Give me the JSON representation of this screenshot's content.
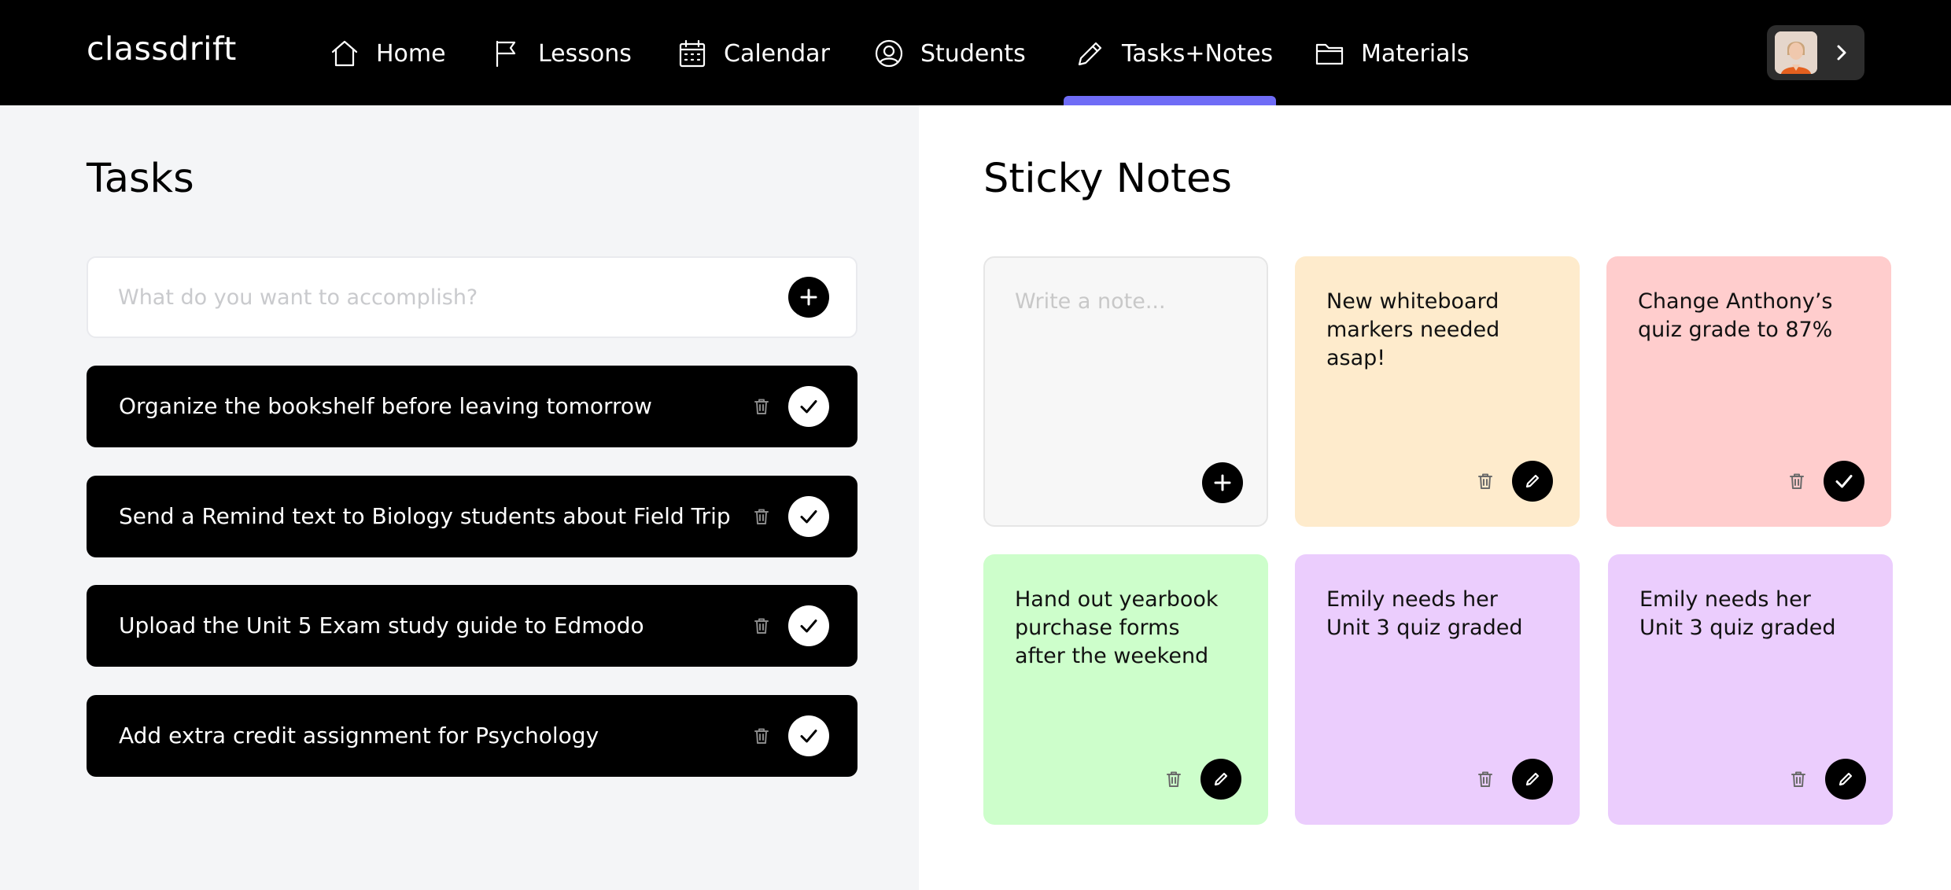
{
  "app": {
    "brand": "classdrift"
  },
  "nav": {
    "items": [
      {
        "label": "Home",
        "icon": "home-icon"
      },
      {
        "label": "Lessons",
        "icon": "flag-icon"
      },
      {
        "label": "Calendar",
        "icon": "calendar-icon"
      },
      {
        "label": "Students",
        "icon": "user-circle-icon"
      },
      {
        "label": "Tasks+Notes",
        "icon": "pencil-icon",
        "active": true
      },
      {
        "label": "Materials",
        "icon": "folder-icon"
      }
    ],
    "active_color": "#6f6cf6"
  },
  "tasks": {
    "title": "Tasks",
    "input_placeholder": "What do you want to accomplish?",
    "items": [
      {
        "label": "Organize the bookshelf before leaving tomorrow"
      },
      {
        "label": "Send a Remind text to Biology students about Field Trip"
      },
      {
        "label": "Upload the Unit 5 Exam study guide to Edmodo"
      },
      {
        "label": "Add extra credit assignment for Psychology"
      }
    ]
  },
  "notes": {
    "title": "Sticky Notes",
    "input_placeholder": "Write a note...",
    "items": [
      {
        "text": "New whiteboard\nmarkers needed\nasap!",
        "color": "#feebcc",
        "action": "edit"
      },
      {
        "text": "Change Anthony’s\nquiz grade to 87%",
        "color": "#ffcdcd",
        "action": "confirm"
      },
      {
        "text": "Hand out yearbook\npurchase forms\nafter the weekend",
        "color": "#cdfecb",
        "action": "edit"
      },
      {
        "text": "Emily needs her\nUnit 3 quiz graded",
        "color": "#ebcdfd",
        "action": "edit"
      },
      {
        "text": "Emily needs her\nUnit 3 quiz graded",
        "color": "#ebcdfd",
        "action": "edit"
      }
    ]
  }
}
